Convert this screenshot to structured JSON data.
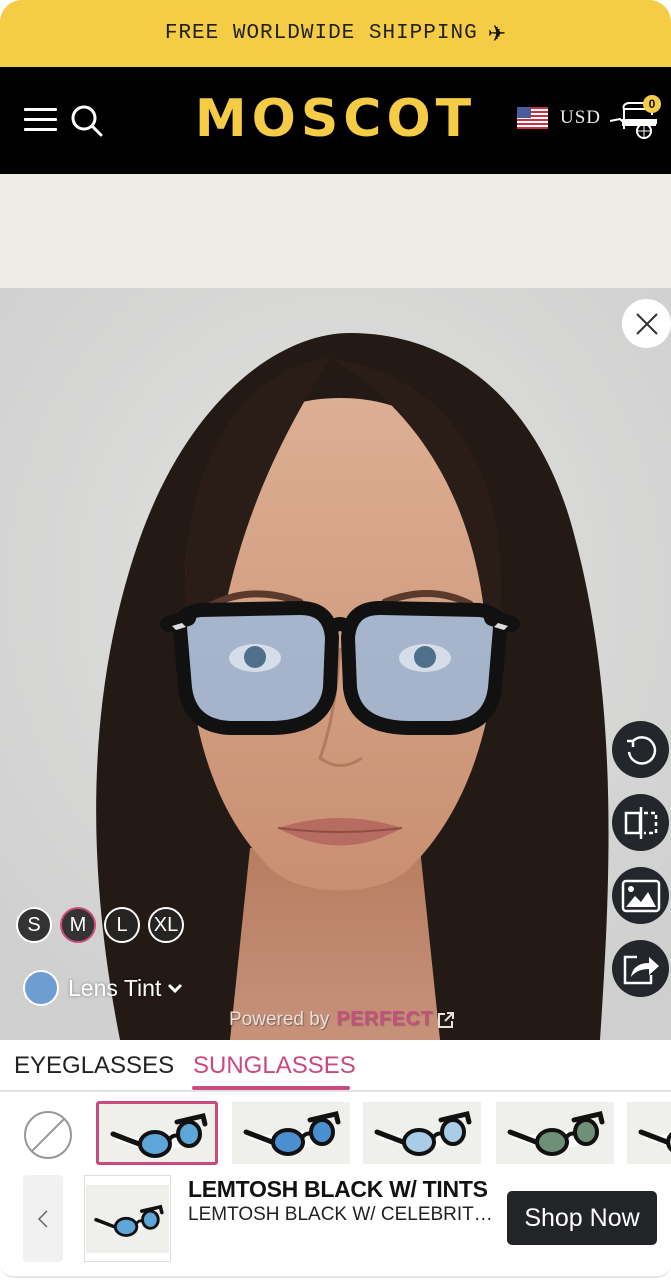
{
  "promo": {
    "text": "FREE WORLDWIDE SHIPPING",
    "icon": "airplane-icon",
    "glyph": "✈"
  },
  "header": {
    "logo": "MOSCOT",
    "menu_icon": "hamburger-menu-icon",
    "search_icon": "search-icon",
    "currency": {
      "flag": "us-flag-icon",
      "label": "USD"
    },
    "cart": {
      "icon": "pushcart-icon",
      "count": "0"
    }
  },
  "tryon": {
    "close_icon": "close-icon",
    "tools": [
      {
        "name": "reset-button",
        "icon": "rotate-reset-icon"
      },
      {
        "name": "compare-button",
        "icon": "split-compare-icon"
      },
      {
        "name": "upload-photo-button",
        "icon": "image-icon"
      },
      {
        "name": "share-button",
        "icon": "share-icon"
      }
    ],
    "sizes": [
      "S",
      "M",
      "L",
      "XL"
    ],
    "selected_size": "M",
    "lens_tint": {
      "label": "Lens Tint",
      "color": "#6e9dd2"
    },
    "powered_by": {
      "label": "Powered by",
      "brand": "PERFECT"
    }
  },
  "tabs": [
    {
      "label": "EYEGLASSES",
      "active": false
    },
    {
      "label": "SUNGLASSES",
      "active": true
    }
  ],
  "thumbnails": [
    {
      "variant": "blue tint",
      "lens": "#5ea6d8",
      "selected": true
    },
    {
      "variant": "blue gradient",
      "lens": "#4a90d0",
      "selected": false
    },
    {
      "variant": "light blue",
      "lens": "#a9cde6",
      "selected": false
    },
    {
      "variant": "green gradient",
      "lens": "#6f8f76",
      "selected": false
    },
    {
      "variant": "partial",
      "lens": "#cccccc",
      "selected": false
    }
  ],
  "product": {
    "title": "LEMTOSH BLACK W/ TINTS",
    "subtitle": "LEMTOSH BLACK W/ CELEBRITY ...",
    "cta": "Shop Now"
  },
  "colors": {
    "accent": "#c94a7c",
    "brand_yellow": "#f5cc45",
    "dark": "#222428"
  }
}
